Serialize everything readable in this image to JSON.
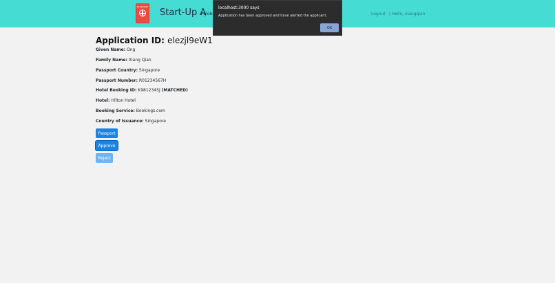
{
  "header": {
    "logo_label": "PASSPORT",
    "brand_title": "Start-Up A",
    "tagline": "a global",
    "logout": "Logout",
    "hello": "| Hello, xiangqian"
  },
  "application": {
    "title_prefix": "Application ID:",
    "id": "elezjl9eW1",
    "fields": [
      {
        "label": "Given Name:",
        "value": "Ong",
        "extra": ""
      },
      {
        "label": "Family Name:",
        "value": "Xiang Qian",
        "extra": ""
      },
      {
        "label": "Passport Country:",
        "value": "Singapore",
        "extra": ""
      },
      {
        "label": "Passport Number:",
        "value": "R01234567H",
        "extra": ""
      },
      {
        "label": "Hotel Booking ID:",
        "value": "K9812345J",
        "extra": "(MATCHED)"
      },
      {
        "label": "Hotel:",
        "value": "Hilton Hotel",
        "extra": ""
      },
      {
        "label": "Booking Service:",
        "value": "Bookings.com",
        "extra": ""
      },
      {
        "label": "Country of Issuance:",
        "value": "Singapore",
        "extra": ""
      }
    ]
  },
  "buttons": {
    "passport": "Passport",
    "approve": "Approve",
    "reject": "Reject"
  },
  "dialog": {
    "title": "localhost:3000 says",
    "message": "Application has been approved and have alerted the applicant.",
    "ok": "OK"
  },
  "colors": {
    "header_bg": "#45dcd3",
    "primary": "#1684e8",
    "dialog_bg": "#2c2c2c",
    "logo": "#ee4a43"
  }
}
